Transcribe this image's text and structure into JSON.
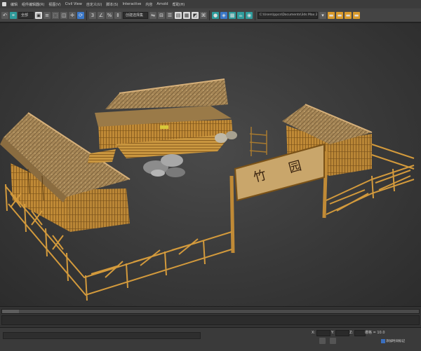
{
  "menu": {
    "items": [
      "编辑(E)",
      "组(G)",
      "视图(V)",
      "创建(C)",
      "修改器(M)",
      "Civil View",
      "自定义(U)",
      "脚本(S)",
      "Interactive",
      "内容",
      "Arnold",
      "帮助(H)"
    ],
    "visible_labels": [
      "编辑",
      "组件编辑器(R)",
      "视图(V)",
      "Civil View",
      "自定义(U)",
      "脚本(S)",
      "Interactive",
      "内容",
      "Arnold",
      "帮助(H)"
    ]
  },
  "toolbar": {
    "selection_filter": "全部",
    "named_selection": "创建选择集",
    "project_path": "C:\\Users\\ppcs\\Documents\\3ds Max 2018"
  },
  "viewport": {
    "sign_text": "竹 园"
  },
  "status": {
    "x_label": "X:",
    "y_label": "Y:",
    "z_label": "Z:",
    "grid": "栅格 = 10.0",
    "add_time_tag": "添加时间标记"
  },
  "colors": {
    "viewport_bg": "#3a3a3a",
    "bamboo": "#c8923a",
    "thatch": "#a98a5a",
    "accent_blue": "#3a78c9"
  }
}
